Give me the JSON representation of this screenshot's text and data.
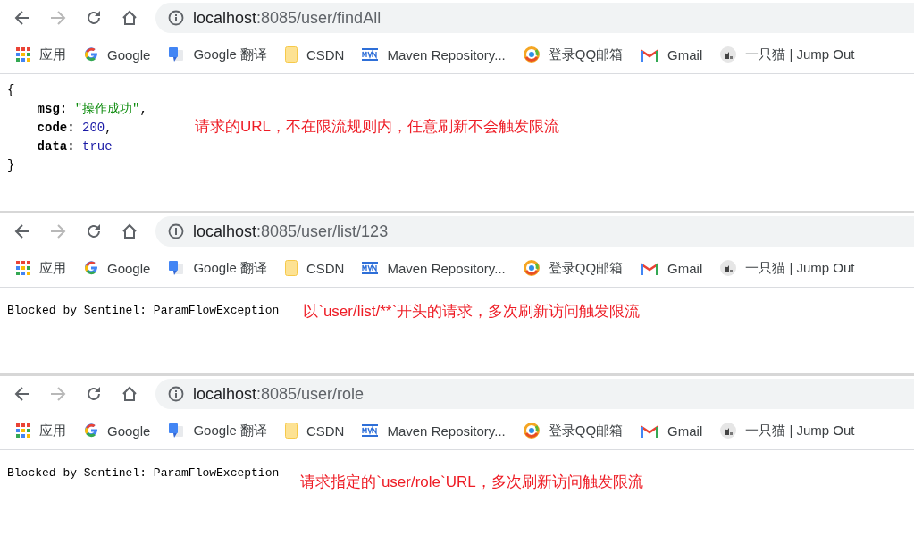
{
  "panels": [
    {
      "address": {
        "host": "localhost",
        "path": ":8085/user/findAll"
      },
      "nav_buttons": [
        {
          "kind": "back",
          "disabled": false
        },
        {
          "kind": "forward",
          "disabled": true
        },
        {
          "kind": "reload",
          "disabled": false
        },
        {
          "kind": "home",
          "disabled": false
        }
      ],
      "bookmarks": [
        {
          "kind": "apps",
          "label": "应用"
        },
        {
          "kind": "google",
          "label": "Google"
        },
        {
          "kind": "translate",
          "label": "Google 翻译"
        },
        {
          "kind": "folder",
          "label": "CSDN"
        },
        {
          "kind": "maven",
          "label": "Maven Repository..."
        },
        {
          "kind": "qq",
          "label": "登录QQ邮箱"
        },
        {
          "kind": "gmail",
          "label": "Gmail"
        },
        {
          "kind": "cat",
          "label": "一只猫 | Jump Out"
        }
      ],
      "content": {
        "kind": "json",
        "lines": [
          {
            "kind": "brace",
            "text": "{"
          },
          {
            "kind": "string",
            "key": "msg:",
            "value": "\"操作成功\"",
            "comma": ","
          },
          {
            "kind": "number",
            "key": "code:",
            "value": "200",
            "comma": ","
          },
          {
            "kind": "boolean",
            "key": "data:",
            "value": "true"
          },
          {
            "kind": "brace",
            "text": "}"
          }
        ],
        "annotation": "请求的URL，不在限流规则内，任意刷新不会触发限流"
      }
    },
    {
      "address": {
        "host": "localhost",
        "path": ":8085/user/list/123"
      },
      "nav_buttons": [
        {
          "kind": "back",
          "disabled": false
        },
        {
          "kind": "forward",
          "disabled": true
        },
        {
          "kind": "reload",
          "disabled": false
        },
        {
          "kind": "home",
          "disabled": false
        }
      ],
      "bookmarks": [
        {
          "kind": "apps",
          "label": "应用"
        },
        {
          "kind": "google",
          "label": "Google"
        },
        {
          "kind": "translate",
          "label": "Google 翻译"
        },
        {
          "kind": "folder",
          "label": "CSDN"
        },
        {
          "kind": "maven",
          "label": "Maven Repository..."
        },
        {
          "kind": "qq",
          "label": "登录QQ邮箱"
        },
        {
          "kind": "gmail",
          "label": "Gmail"
        },
        {
          "kind": "cat",
          "label": "一只猫 | Jump Out"
        }
      ],
      "content": {
        "kind": "text",
        "message": "Blocked by Sentinel: ParamFlowException",
        "annotation": "以`user/list/**`开头的请求，多次刷新访问触发限流"
      }
    },
    {
      "address": {
        "host": "localhost",
        "path": ":8085/user/role"
      },
      "nav_buttons": [
        {
          "kind": "back",
          "disabled": false
        },
        {
          "kind": "forward",
          "disabled": true
        },
        {
          "kind": "reload",
          "disabled": false
        },
        {
          "kind": "home",
          "disabled": false
        }
      ],
      "bookmarks": [
        {
          "kind": "apps",
          "label": "应用"
        },
        {
          "kind": "google",
          "label": "Google"
        },
        {
          "kind": "translate",
          "label": "Google 翻译"
        },
        {
          "kind": "folder",
          "label": "CSDN"
        },
        {
          "kind": "maven",
          "label": "Maven Repository..."
        },
        {
          "kind": "qq",
          "label": "登录QQ邮箱"
        },
        {
          "kind": "gmail",
          "label": "Gmail"
        },
        {
          "kind": "cat",
          "label": "一只猫 | Jump Out"
        }
      ],
      "content": {
        "kind": "text",
        "message": "Blocked by Sentinel: ParamFlowException",
        "annotation": "请求指定的`user/role`URL，多次刷新访问触发限流"
      }
    }
  ]
}
